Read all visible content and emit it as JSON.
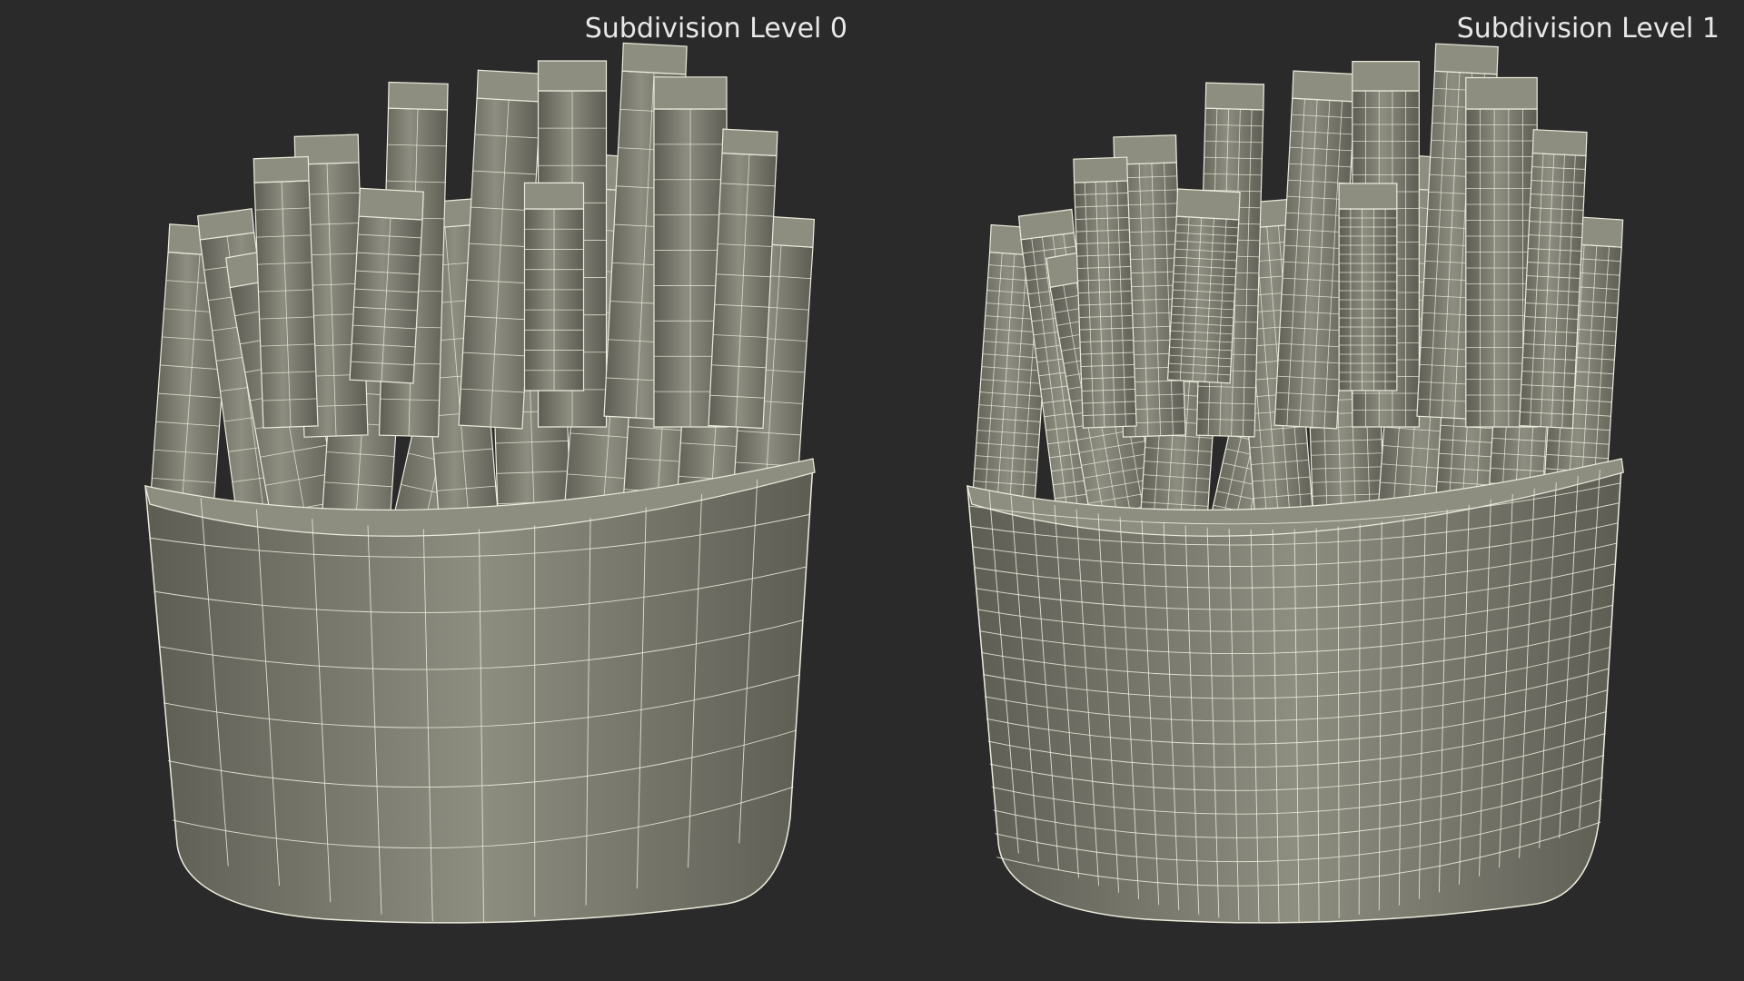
{
  "views": [
    {
      "label": "Subdivision Level 0",
      "subdivision": 0
    },
    {
      "label": "Subdivision Level 1",
      "subdivision": 1
    }
  ],
  "colors": {
    "background": "#2a2a2a",
    "mesh_fill": "#7a7a6e",
    "mesh_shadow": "#5d5d54",
    "mesh_highlight": "#8d8d80",
    "wire": "#ecebdc",
    "label": "#e8e8e8"
  }
}
